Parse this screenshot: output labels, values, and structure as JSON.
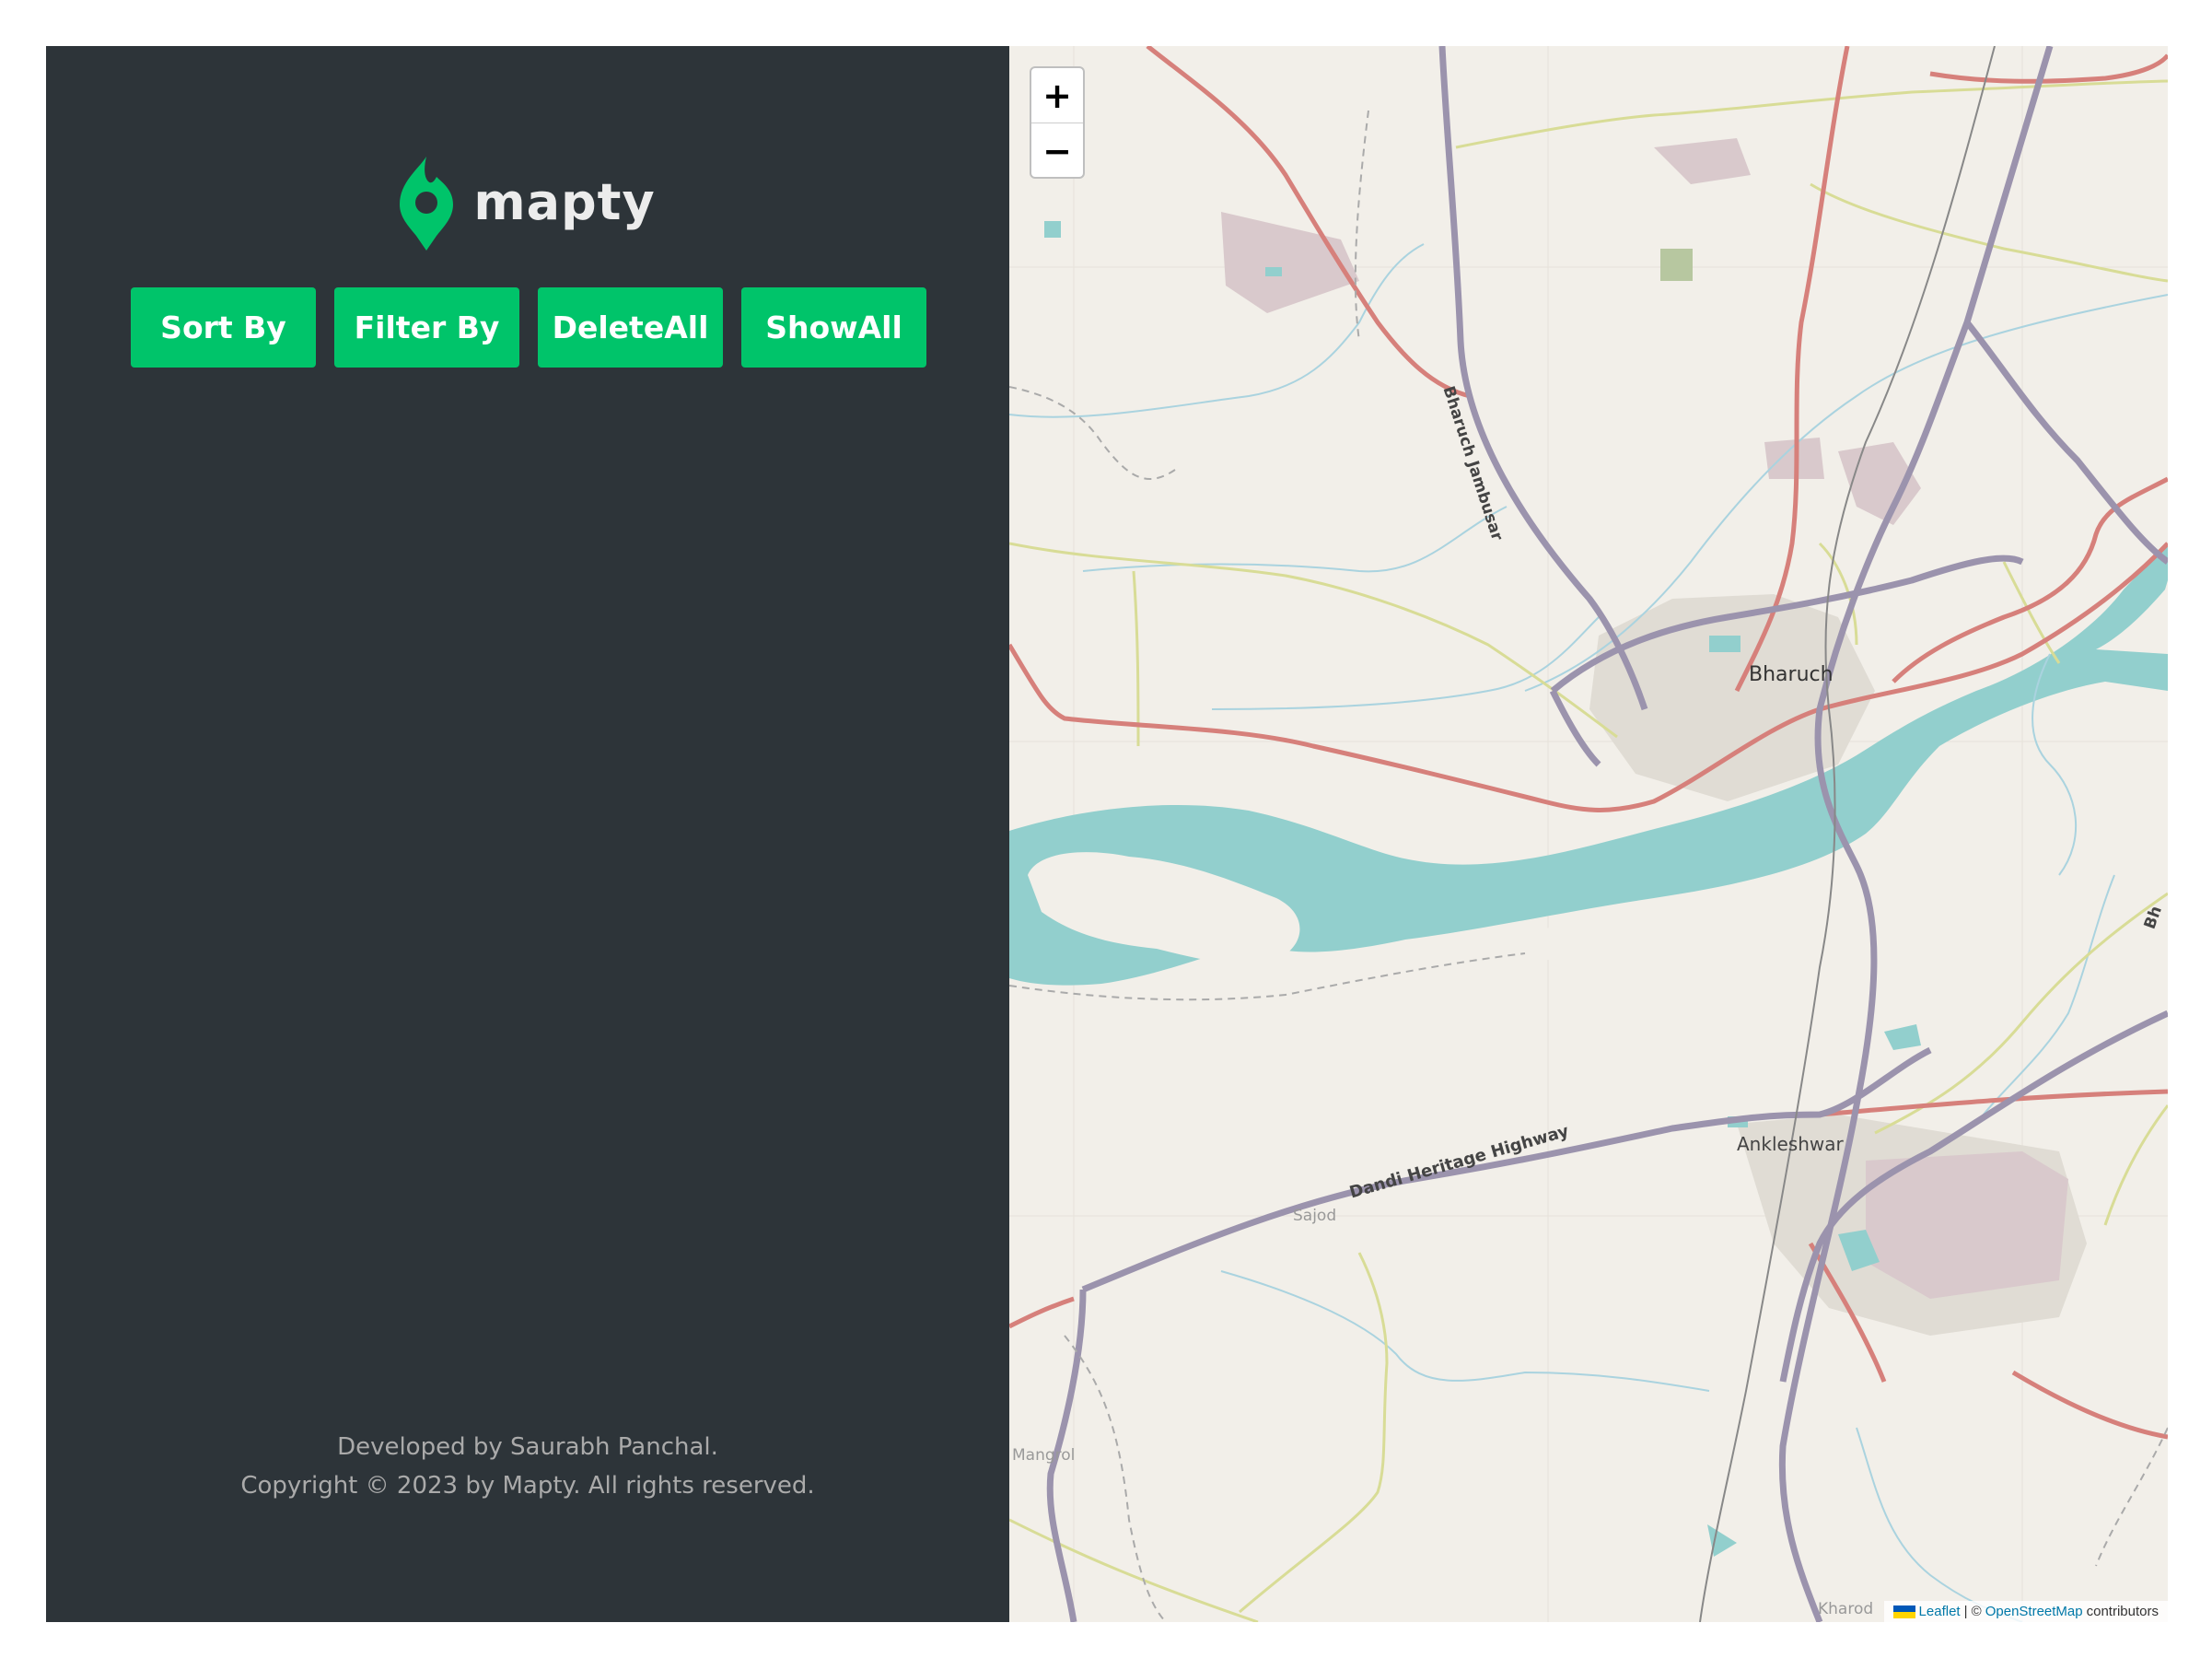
{
  "app": {
    "logo_text": "mapty",
    "brand_color": "#00c46a",
    "sidebar_bg": "#2d3439"
  },
  "buttons": {
    "sort": "Sort By",
    "filter": "Filter By",
    "delete_all": "DeleteAll",
    "show_all": "ShowAll"
  },
  "footer": {
    "line1": "Developed by Saurabh Panchal.",
    "line2": "Copyright © 2023 by Mapty. All rights reserved."
  },
  "map": {
    "zoom_in": "+",
    "zoom_out": "−",
    "labels": {
      "bharuch": "Bharuch",
      "ankleshwar": "Ankleshwar",
      "highway": "Dandi Heritage Highway",
      "bharuch_jambusar": "Bharuch Jambusar",
      "sajod": "Sajod",
      "mangrol": "Mangrol",
      "kharod": "Kharod",
      "bh_edge": "Bh"
    },
    "attribution": {
      "leaflet": "Leaflet",
      "sep": "| ©",
      "osm": "OpenStreetMap",
      "contributors": "contributors"
    },
    "colors": {
      "river": "#92cfcd",
      "primary_road": "#9b93ad",
      "secondary_road": "#d6807b",
      "tertiary_road": "#d8dc96",
      "land": "#f2efe9"
    }
  }
}
